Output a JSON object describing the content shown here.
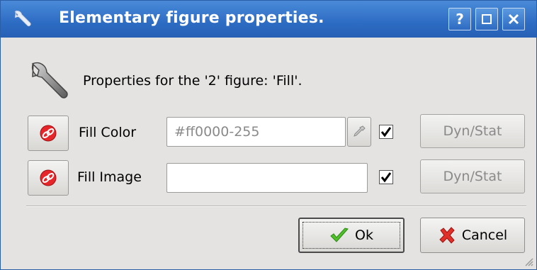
{
  "window": {
    "title": "Elementary figure properties.",
    "help_label": "?",
    "title_color": "#2d6cc3"
  },
  "header": {
    "text": "Properties for the '2' figure: 'Fill'."
  },
  "rows": [
    {
      "label": "Fill Color",
      "value": "#ff0000-255",
      "checked": true,
      "dyn_label": "Dyn/Stat"
    },
    {
      "label": "Fill Image",
      "value": "",
      "checked": true,
      "dyn_label": "Dyn/Stat"
    }
  ],
  "buttons": {
    "ok_label": "Ok",
    "cancel_label": "Cancel"
  },
  "icons": {
    "title": "wrench-icon",
    "header": "wrench-icon",
    "row_toggle": "red-link-icon",
    "color_picker": "pipette-icon",
    "ok": "green-check-icon",
    "cancel": "red-x-icon"
  }
}
